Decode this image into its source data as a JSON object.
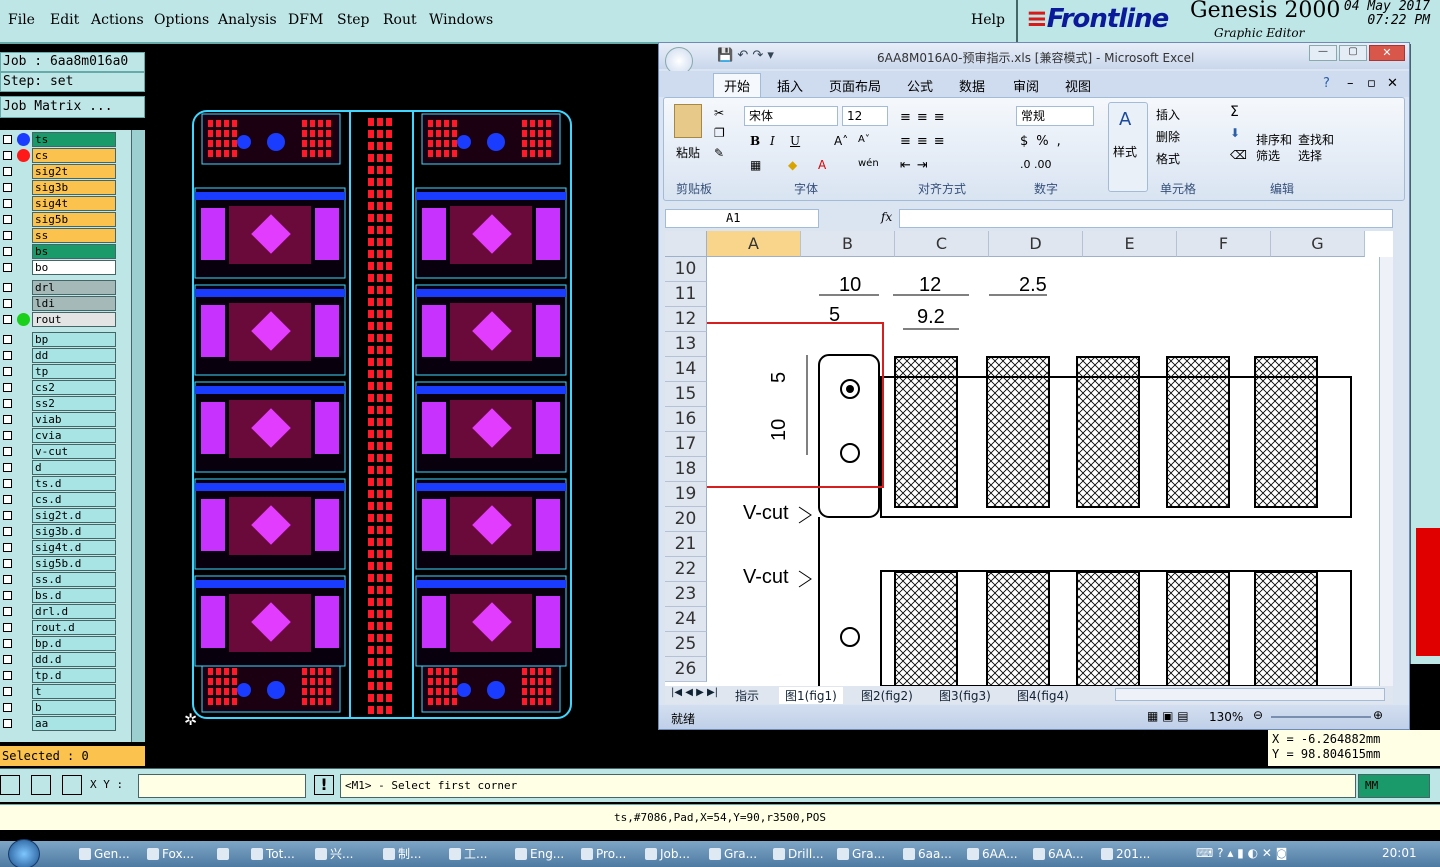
{
  "genesis": {
    "menu": [
      "File",
      "Edit",
      "Actions",
      "Options",
      "Analysis",
      "DFM",
      "Step",
      "Rout",
      "Windows"
    ],
    "help": "Help",
    "brand": "Frontline",
    "app_title": "Genesis 2000",
    "subtitle": "Graphic Editor",
    "date": "04 May 2017",
    "time": "07:22 PM",
    "job": "Job : 6aa8m016a0",
    "step": "Step: set",
    "job_matrix": "Job Matrix ...",
    "layers": [
      {
        "name": "ts",
        "color": "#1a9a6a",
        "dot": "#1a3cff"
      },
      {
        "name": "cs",
        "color": "#fbc24e",
        "dot": "#ff1a1a"
      },
      {
        "name": "sig2t",
        "color": "#fbc24e",
        "dot": ""
      },
      {
        "name": "sig3b",
        "color": "#fbc24e",
        "dot": ""
      },
      {
        "name": "sig4t",
        "color": "#fbc24e",
        "dot": ""
      },
      {
        "name": "sig5b",
        "color": "#fbc24e",
        "dot": ""
      },
      {
        "name": "ss",
        "color": "#fbc24e",
        "dot": ""
      },
      {
        "name": "bs",
        "color": "#1a9a6a",
        "dot": ""
      },
      {
        "name": "bo",
        "color": "#ffffff",
        "dot": ""
      },
      {
        "name": "drl",
        "color": "#a6b9b9",
        "dot": ""
      },
      {
        "name": "ldi",
        "color": "#a6b9b9",
        "dot": ""
      },
      {
        "name": "rout",
        "color": "#e4e4e4",
        "dot": "#1ad01a"
      },
      {
        "name": "bp",
        "color": "#a8e4e4",
        "dot": ""
      },
      {
        "name": "dd",
        "color": "#a8e4e4",
        "dot": ""
      },
      {
        "name": "tp",
        "color": "#a8e4e4",
        "dot": ""
      },
      {
        "name": "cs2",
        "color": "#a8e4e4",
        "dot": ""
      },
      {
        "name": "ss2",
        "color": "#a8e4e4",
        "dot": ""
      },
      {
        "name": "viab",
        "color": "#a8e4e4",
        "dot": ""
      },
      {
        "name": "cvia",
        "color": "#a8e4e4",
        "dot": ""
      },
      {
        "name": "v-cut",
        "color": "#a8e4e4",
        "dot": ""
      },
      {
        "name": "d",
        "color": "#a8e4e4",
        "dot": ""
      },
      {
        "name": "ts.d",
        "color": "#a8e4e4",
        "dot": ""
      },
      {
        "name": "cs.d",
        "color": "#a8e4e4",
        "dot": ""
      },
      {
        "name": "sig2t.d",
        "color": "#a8e4e4",
        "dot": ""
      },
      {
        "name": "sig3b.d",
        "color": "#a8e4e4",
        "dot": ""
      },
      {
        "name": "sig4t.d",
        "color": "#a8e4e4",
        "dot": ""
      },
      {
        "name": "sig5b.d",
        "color": "#a8e4e4",
        "dot": ""
      },
      {
        "name": "ss.d",
        "color": "#a8e4e4",
        "dot": ""
      },
      {
        "name": "bs.d",
        "color": "#a8e4e4",
        "dot": ""
      },
      {
        "name": "drl.d",
        "color": "#a8e4e4",
        "dot": ""
      },
      {
        "name": "rout.d",
        "color": "#a8e4e4",
        "dot": ""
      },
      {
        "name": "bp.d",
        "color": "#a8e4e4",
        "dot": ""
      },
      {
        "name": "dd.d",
        "color": "#a8e4e4",
        "dot": ""
      },
      {
        "name": "tp.d",
        "color": "#a8e4e4",
        "dot": ""
      },
      {
        "name": "t",
        "color": "#a8e4e4",
        "dot": ""
      },
      {
        "name": "b",
        "color": "#a8e4e4",
        "dot": ""
      },
      {
        "name": "aa",
        "color": "#a8e4e4",
        "dot": ""
      }
    ],
    "selected": "Selected : 0",
    "xy_label": "X Y :",
    "prompt": "<M1> - Select first corner",
    "coord_x": "X = -6.264882mm",
    "coord_y": "Y = 98.804615mm",
    "units": "MM",
    "info": "ts,#7086,Pad,X=54,Y=90,r3500,POS"
  },
  "excel": {
    "title": "6AA8M016A0-预审指示.xls  [兼容模式] - Microsoft Excel",
    "tabs": [
      "开始",
      "插入",
      "页面布局",
      "公式",
      "数据",
      "审阅",
      "视图"
    ],
    "font_name": "宋体",
    "font_size": "12",
    "number_format": "常规",
    "groups": [
      "剪贴板",
      "字体",
      "对齐方式",
      "数字",
      "样式",
      "单元格",
      "编辑"
    ],
    "paste": "粘贴",
    "style": "样式",
    "insert": "插入",
    "delete": "删除",
    "format": "格式",
    "sort": "排序和\n筛选",
    "find": "查找和\n选择",
    "name_box": "A1",
    "fx": "fx",
    "columns": [
      "A",
      "B",
      "C",
      "D",
      "E",
      "F",
      "G"
    ],
    "rows": [
      "10",
      "11",
      "12",
      "13",
      "14",
      "15",
      "16",
      "17",
      "18",
      "19",
      "20",
      "21",
      "22",
      "23",
      "24",
      "25",
      "26"
    ],
    "sheet_tabs": [
      "指示",
      "图1(fig1)",
      "图2(fig2)",
      "图3(fig3)",
      "图4(fig4)"
    ],
    "status_ready": "就绪",
    "zoom": "130%",
    "drawing": {
      "dim_10": "10",
      "dim_12": "12",
      "dim_2_5": "2.5",
      "dim_5_top": "5",
      "dim_9_2": "9.2",
      "dim_5_side": "5",
      "dim_10_side": "10",
      "vcut_1": "V-cut",
      "vcut_2": "V-cut"
    }
  },
  "taskbar": {
    "items": [
      "Gen...",
      "Fox...",
      "",
      "Tot...",
      "兴...",
      "制...",
      "工...",
      "Eng...",
      "Pro...",
      "Job...",
      "Gra...",
      "Drill...",
      "Gra...",
      "6aa...",
      "6AA...",
      "6AA...",
      "201..."
    ],
    "clock": "20:01"
  }
}
